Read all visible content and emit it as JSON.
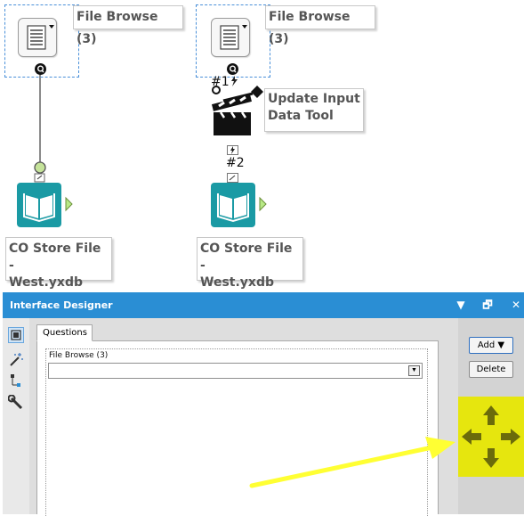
{
  "canvas": {
    "tool_left": {
      "annotation": "File Browse (3)",
      "connection_tag": ""
    },
    "tool_right": {
      "annotation": "File Browse (3)",
      "connection_tag": "#1"
    },
    "update_tool": {
      "annotation_line1": "Update Input",
      "annotation_line2": "Data Tool",
      "connection_tag": "#2"
    },
    "output_left": {
      "annotation_line1": "CO Store File -",
      "annotation_line2": "West.yxdb"
    },
    "output_right": {
      "annotation_line1": "CO Store File -",
      "annotation_line2": "West.yxdb"
    }
  },
  "interface_designer": {
    "title": "Interface Designer",
    "title_buttons": {
      "menu": "▼",
      "restore": "🗗",
      "close": "✕"
    },
    "tab_questions": "Questions",
    "question_label": "File Browse (3)",
    "question_value": "",
    "add_button": "Add ▼",
    "delete_button": "Delete",
    "sidebar_icons": [
      "layout-view-icon",
      "magic-wand-icon",
      "tree-view-icon",
      "wrench-icon"
    ]
  },
  "colors": {
    "titlebar": "#2a8ed4",
    "move_highlight": "#e6e60e",
    "move_arrows": "#6b6b0b",
    "annotation_arrow": "#ffff33",
    "book_icon": "#1a9aa4",
    "connector_output": "#b8e986"
  }
}
